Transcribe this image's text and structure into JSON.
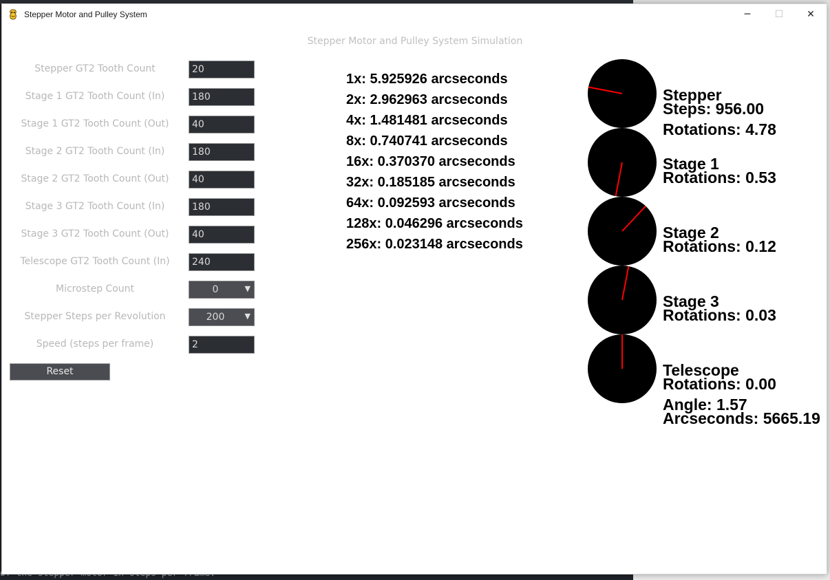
{
  "window": {
    "title": "Stepper Motor and Pulley System",
    "controls": {
      "minimize": "─",
      "maximize": "☐",
      "close": "✕"
    }
  },
  "background": {
    "terminal_text": "of the stepper motor in steps per frame."
  },
  "simulation_title": "Stepper Motor and Pulley System Simulation",
  "fields": [
    {
      "label": "Stepper GT2 Tooth Count",
      "value": "20",
      "type": "input"
    },
    {
      "label": "Stage 1 GT2 Tooth Count (In)",
      "value": "180",
      "type": "input"
    },
    {
      "label": "Stage 1 GT2 Tooth Count (Out)",
      "value": "40",
      "type": "input"
    },
    {
      "label": "Stage 2 GT2 Tooth Count (In)",
      "value": "180",
      "type": "input"
    },
    {
      "label": "Stage 2 GT2 Tooth Count (Out)",
      "value": "40",
      "type": "input"
    },
    {
      "label": "Stage 3 GT2 Tooth Count (In)",
      "value": "180",
      "type": "input"
    },
    {
      "label": "Stage 3 GT2 Tooth Count (Out)",
      "value": "40",
      "type": "input"
    },
    {
      "label": "Telescope GT2 Tooth Count (In)",
      "value": "240",
      "type": "input"
    },
    {
      "label": "Microstep Count",
      "value": "0",
      "type": "select"
    },
    {
      "label": "Stepper Steps per Revolution",
      "value": "200",
      "type": "select"
    },
    {
      "label": "Speed (steps per frame)",
      "value": "2",
      "type": "input"
    }
  ],
  "reset_label": "Reset",
  "resolutions": [
    "1x: 5.925926 arcseconds",
    "2x: 2.962963 arcseconds",
    "4x: 1.481481 arcseconds",
    "8x: 0.740741 arcseconds",
    "16x: 0.370370 arcseconds",
    "32x: 0.185185 arcseconds",
    "64x: 0.092593 arcseconds",
    "128x: 0.046296 arcseconds",
    "256x: 0.023148 arcseconds"
  ],
  "disks": [
    {
      "name": "Stepper",
      "lines": [
        "Stepper",
        "Steps: 956.00",
        "Rotations: 4.78"
      ],
      "rotations": 4.78
    },
    {
      "name": "Stage 1",
      "lines": [
        "Stage 1",
        "Rotations: 0.53"
      ],
      "rotations": 0.53
    },
    {
      "name": "Stage 2",
      "lines": [
        "Stage 2",
        "Rotations: 0.12"
      ],
      "rotations": 0.12
    },
    {
      "name": "Stage 3",
      "lines": [
        "Stage 3",
        "Rotations: 0.03"
      ],
      "rotations": 0.03
    },
    {
      "name": "Telescope",
      "lines": [
        "Telescope",
        "Rotations: 0.00",
        "Angle: 1.57",
        "Arcseconds: 5665.19"
      ],
      "rotations": 0.0
    }
  ],
  "colors": {
    "disk": "#000000",
    "indicator": "#ff0000",
    "input_bg": "#2b2e33",
    "select_bg": "#4b4d52",
    "label": "#b8b8b8"
  }
}
